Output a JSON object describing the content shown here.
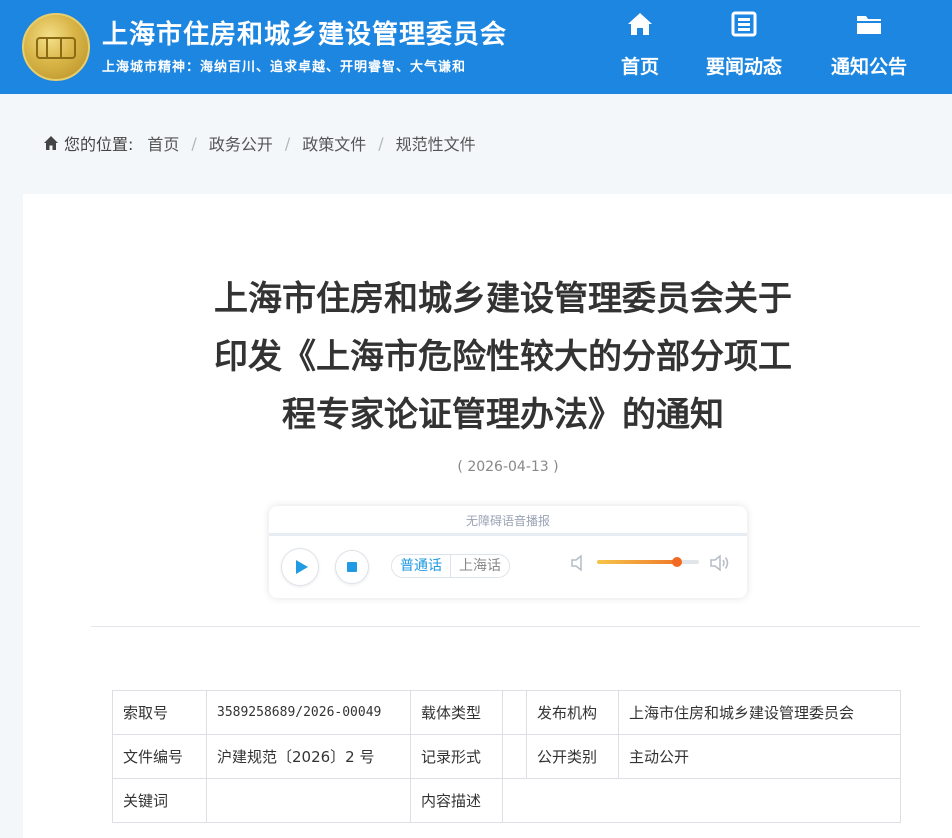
{
  "header": {
    "site_title": "上海市住房和城乡建设管理委员会",
    "motto": "上海城市精神：海纳百川、追求卓越、开明睿智、大气谦和",
    "nav": [
      {
        "label": "首页",
        "icon": "home-icon"
      },
      {
        "label": "要闻动态",
        "icon": "newspaper-icon"
      },
      {
        "label": "通知公告",
        "icon": "folder-icon"
      }
    ],
    "color": "#1c86e0"
  },
  "breadcrumb": {
    "prefix": "您的位置:",
    "items": [
      "首页",
      "政务公开",
      "政策文件",
      "规范性文件"
    ]
  },
  "article": {
    "title_lines": [
      "上海市住房和城乡建设管理委员会关于",
      "印发《上海市危险性较大的分部分项工",
      "程专家论证管理办法》的通知"
    ],
    "date": "( 2026-04-13 )"
  },
  "player": {
    "title": "无障碍语音播报",
    "languages": [
      "普通话",
      "上海话"
    ],
    "volume_percent": 78,
    "accent": "#1f9ae3"
  },
  "info": {
    "rows": [
      [
        "索取号",
        "3589258689/2026-00049",
        "载体类型",
        "",
        "发布机构",
        "上海市住房和城乡建设管理委员会"
      ],
      [
        "文件编号",
        "沪建规范〔2026〕2 号",
        "记录形式",
        "",
        "公开类别",
        "主动公开"
      ],
      [
        "关键词",
        "",
        "内容描述",
        ""
      ]
    ]
  }
}
